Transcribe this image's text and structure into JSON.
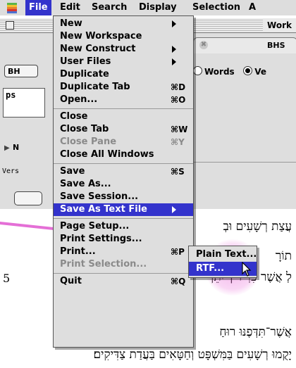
{
  "menubar": {
    "apple_icon": "apple-icon",
    "items": [
      "File",
      "Edit",
      "Search",
      "Display",
      "Selection",
      "A"
    ]
  },
  "window": {
    "title": "Work",
    "tab_label": "BHS",
    "button_label": "BH",
    "radio_words": "Words",
    "radio_verse": "Ve",
    "query_text": "ps",
    "tri_label": "N",
    "vers_label": "Vers"
  },
  "text_panel": {
    "lines": [
      "עֲצַת רְשָׁעִים וּבְ",
      "תוֹרָ",
      "לְ         אֲשֶׁר פִּרְיוֹ ׀ יִתֵּן",
      "אֲשֶׁר־תִּדְּפֶנּוּ רוּחַ",
      "יָקֻמוּ רְשָׁעִים בַּמִּשְׁפָּט וְחַטָּאִים בַּעֲדַת צַדִּיקִים׃"
    ],
    "verse_number": "5"
  },
  "file_menu": {
    "items": [
      {
        "label": "New",
        "shortcut": "",
        "submenu": true,
        "disabled": false
      },
      {
        "label": "New Workspace",
        "shortcut": "",
        "submenu": false,
        "disabled": false
      },
      {
        "label": "New Construct",
        "shortcut": "",
        "submenu": true,
        "disabled": false
      },
      {
        "label": "User Files",
        "shortcut": "",
        "submenu": true,
        "disabled": false
      },
      {
        "label": "Duplicate",
        "shortcut": "",
        "submenu": false,
        "disabled": false
      },
      {
        "label": "Duplicate Tab",
        "shortcut": "⌘D",
        "submenu": false,
        "disabled": false
      },
      {
        "label": "Open...",
        "shortcut": "⌘O",
        "submenu": false,
        "disabled": false
      },
      {
        "label": "Close",
        "shortcut": "",
        "submenu": false,
        "disabled": false
      },
      {
        "label": "Close Tab",
        "shortcut": "⌘W",
        "submenu": false,
        "disabled": false
      },
      {
        "label": "Close Pane",
        "shortcut": "⌘Y",
        "submenu": false,
        "disabled": true
      },
      {
        "label": "Close All Windows",
        "shortcut": "",
        "submenu": false,
        "disabled": false
      },
      {
        "label": "Save",
        "shortcut": "⌘S",
        "submenu": false,
        "disabled": false
      },
      {
        "label": "Save As...",
        "shortcut": "",
        "submenu": false,
        "disabled": false
      },
      {
        "label": "Save Session...",
        "shortcut": "",
        "submenu": false,
        "disabled": false
      },
      {
        "label": "Save As Text File",
        "shortcut": "",
        "submenu": true,
        "disabled": false,
        "highlighted": true
      },
      {
        "label": "Page Setup...",
        "shortcut": "",
        "submenu": false,
        "disabled": false
      },
      {
        "label": "Print Settings...",
        "shortcut": "",
        "submenu": false,
        "disabled": false
      },
      {
        "label": "Print...",
        "shortcut": "⌘P",
        "submenu": false,
        "disabled": false
      },
      {
        "label": "Print Selection...",
        "shortcut": "",
        "submenu": false,
        "disabled": true
      },
      {
        "label": "Quit",
        "shortcut": "⌘Q",
        "submenu": false,
        "disabled": false
      }
    ]
  },
  "submenu": {
    "items": [
      {
        "label": "Plain Text...",
        "highlighted": false
      },
      {
        "label": "RTF...",
        "highlighted": true
      }
    ]
  },
  "colors": {
    "highlight": "#3333cc",
    "menu_bg": "#dedede",
    "annotation": "#e46fd6"
  }
}
